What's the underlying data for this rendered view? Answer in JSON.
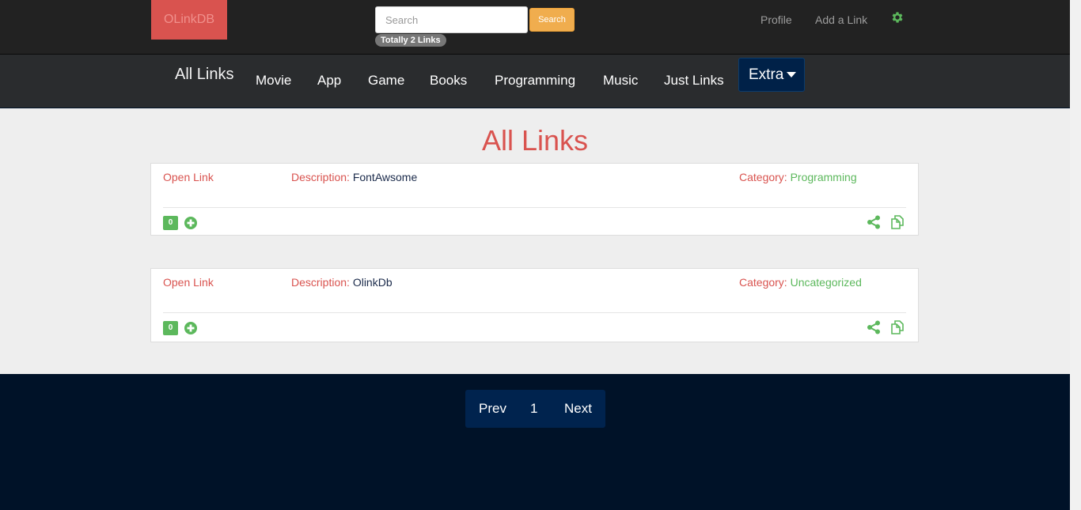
{
  "header": {
    "brand": "OLinkDB",
    "search_placeholder": "Search",
    "search_button": "Search",
    "total_badge": "Totally 2 Links",
    "profile_link": "Profile",
    "add_link": "Add a Link",
    "settings_icon": "gear-icon"
  },
  "categories": {
    "all": "All Links",
    "items": [
      "Movie",
      "App",
      "Game",
      "Books",
      "Programming",
      "Music",
      "Just Links"
    ],
    "extra": "Extra"
  },
  "main": {
    "heading": "All Links",
    "links": [
      {
        "open_label": "Open Link",
        "description_label": "Description:",
        "description": "FontAwsome",
        "category_label": "Category:",
        "category": "Programming",
        "votes": "0"
      },
      {
        "open_label": "Open Link",
        "description_label": "Description:",
        "description": "OlinkDb",
        "category_label": "Category:",
        "category": "Uncategorized",
        "votes": "0"
      }
    ]
  },
  "pagination": {
    "prev": "Prev",
    "page": "1",
    "next": "Next"
  },
  "colors": {
    "accent_red": "#d9534f",
    "accent_green": "#5cb85c",
    "search_orange": "#f0ad4e",
    "navy": "#001228"
  }
}
